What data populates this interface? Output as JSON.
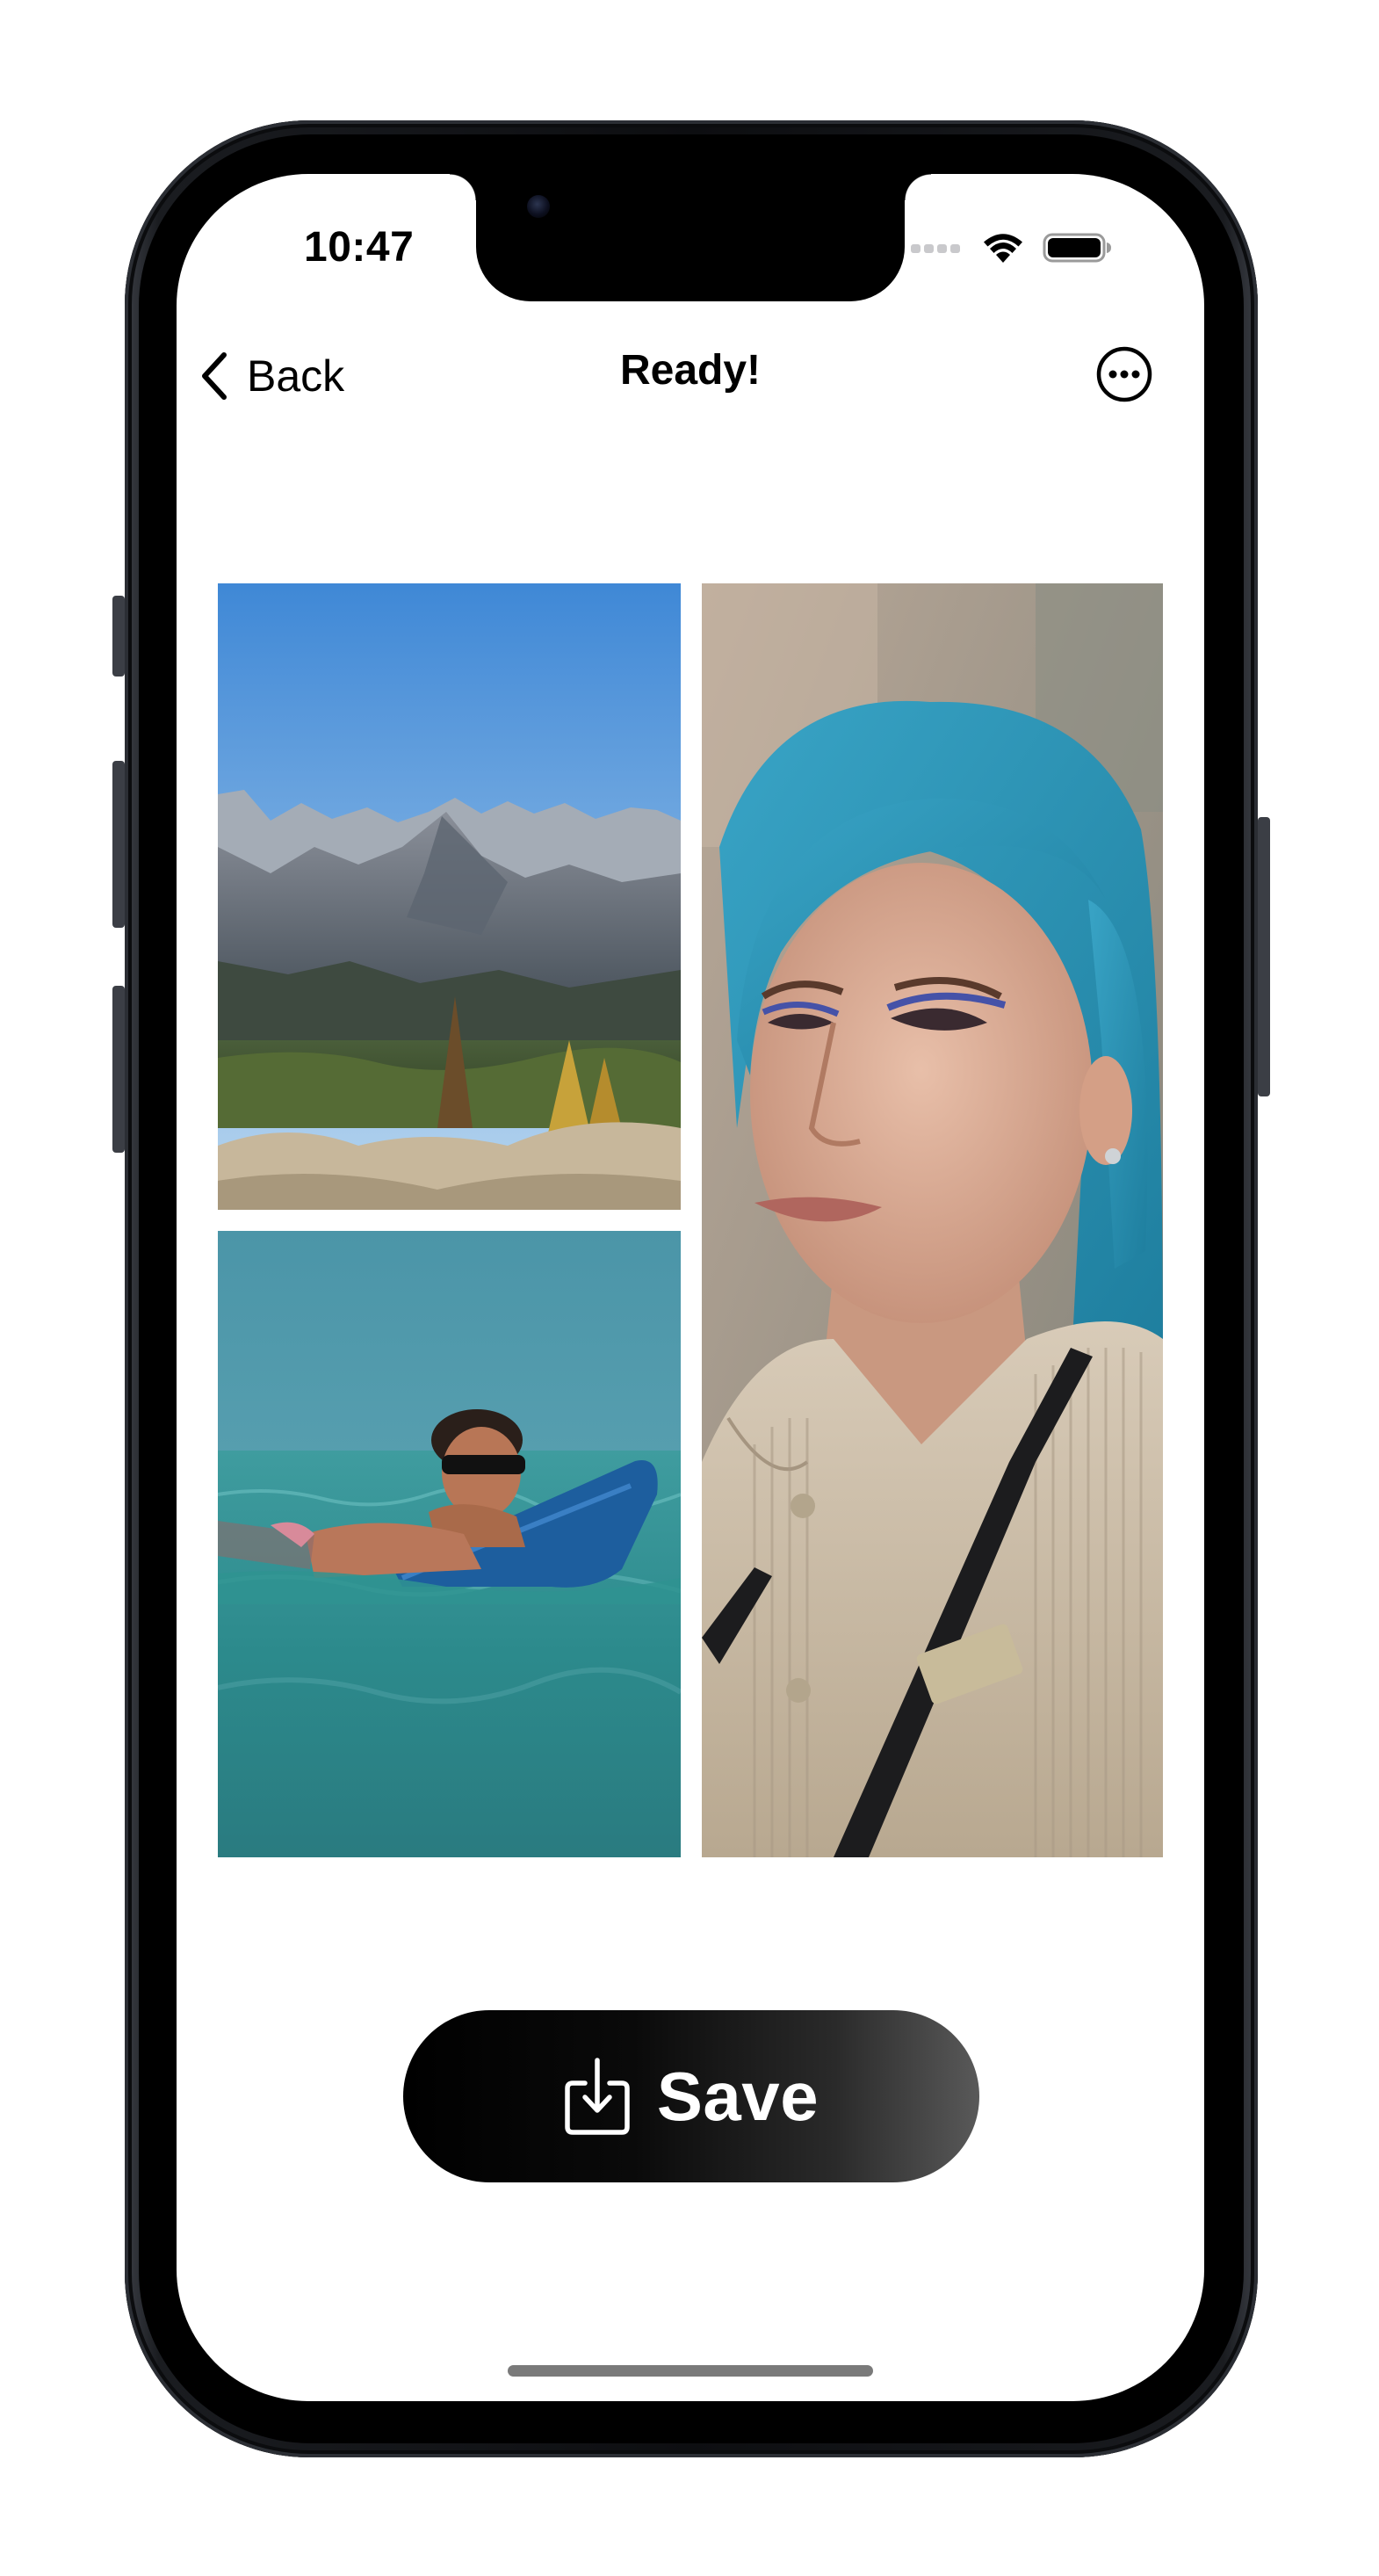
{
  "status_bar": {
    "time": "10:47"
  },
  "nav": {
    "back_label": "Back",
    "title": "Ready!",
    "more_icon": "ellipsis-circle-icon"
  },
  "collage": {
    "photos": [
      {
        "name": "mountain-photo",
        "subject": "mountain landscape"
      },
      {
        "name": "surfer-photo",
        "subject": "man with surfboard in sea"
      },
      {
        "name": "portrait-photo",
        "subject": "woman with blue hair"
      }
    ]
  },
  "actions": {
    "save_label": "Save",
    "save_icon": "download-tray-icon"
  },
  "colors": {
    "background": "#ffffff",
    "button_dark": "#000000",
    "button_light": "#595959",
    "text": "#000000"
  }
}
